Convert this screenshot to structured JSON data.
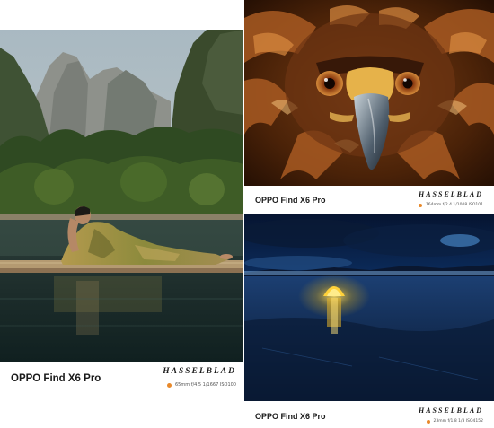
{
  "accent_dot_color": "#e8892b",
  "photos": [
    {
      "id": "lake",
      "device": "OPPO Find X6 Pro",
      "brand": "HASSELBLAD",
      "params": "65mm f/4.5 1/1667 ISO100"
    },
    {
      "id": "eagle",
      "device": "OPPO Find X6 Pro",
      "brand": "HASSELBLAD",
      "params": "164mm f/2.4 1/1008 ISO101"
    },
    {
      "id": "night",
      "device": "OPPO Find X6 Pro",
      "brand": "HASSELBLAD",
      "params": "23mm f/1.8 1/3 ISO4152"
    }
  ]
}
